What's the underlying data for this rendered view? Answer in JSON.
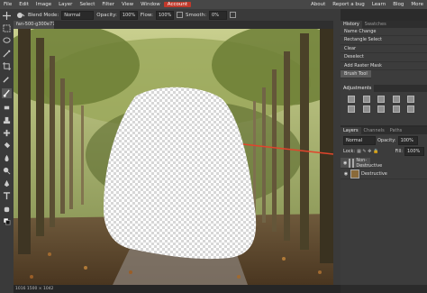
{
  "menu": {
    "items": [
      "File",
      "Edit",
      "Image",
      "Layer",
      "Select",
      "Filter",
      "View",
      "Window"
    ],
    "account": "Account",
    "right": [
      "About",
      "Report a bug",
      "Learn",
      "Blog",
      "More"
    ]
  },
  "options": {
    "blend_label": "Blend Mode:",
    "blend_value": "Normal",
    "opacity_label": "Opacity:",
    "opacity_value": "100%",
    "flow_label": "Flow:",
    "flow_value": "100%",
    "smooth_label": "Smooth:",
    "smooth_value": "0%"
  },
  "document": {
    "tab_title": "fan-500-g300e7788...",
    "status": "1016  1500 × 1042"
  },
  "history": {
    "tabs": [
      "History",
      "Swatches"
    ],
    "items": [
      "Name Change",
      "Rectangle Select",
      "Clear",
      "Deselect",
      "Add Raster Mask",
      "Brush Tool"
    ],
    "selected_index": 5
  },
  "adjustments": {
    "title": "Adjustments"
  },
  "layers": {
    "tabs": [
      "Layers",
      "Channels",
      "Paths"
    ],
    "blend": "Normal",
    "opacity_label": "Opacity:",
    "opacity": "100%",
    "lock_label": "Lock:",
    "fill_label": "Fill:",
    "fill": "100%",
    "items": [
      "Non-Destructive",
      "Destructive"
    ]
  },
  "colors": {
    "accent": "#e0452c",
    "account": "#c0392b"
  }
}
